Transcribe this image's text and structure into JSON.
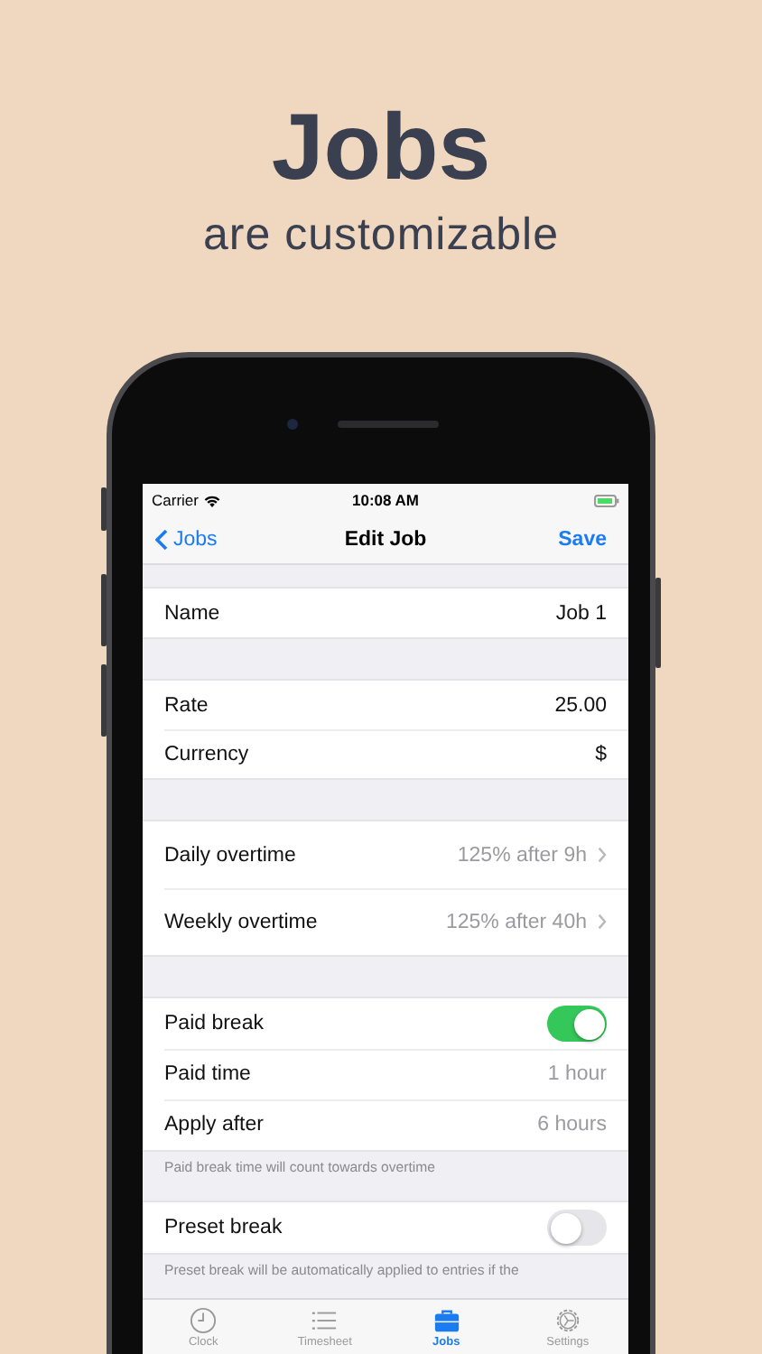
{
  "headline": "Jobs",
  "subheadline": "are customizable",
  "status_bar": {
    "carrier": "Carrier",
    "time": "10:08 AM"
  },
  "nav": {
    "back": "Jobs",
    "title": "Edit Job",
    "action": "Save"
  },
  "sections": [
    {
      "rows": [
        {
          "kind": "value",
          "label": "Name",
          "value": "Job 1"
        }
      ]
    },
    {
      "rows": [
        {
          "kind": "value",
          "label": "Rate",
          "value": "25.00"
        },
        {
          "kind": "value",
          "label": "Currency",
          "value": "$"
        }
      ]
    },
    {
      "rows": [
        {
          "kind": "disclosure",
          "label": "Daily overtime",
          "value": "125% after 9h"
        },
        {
          "kind": "disclosure",
          "label": "Weekly overtime",
          "value": "125% after 40h"
        }
      ]
    },
    {
      "rows": [
        {
          "kind": "toggle",
          "label": "Paid break",
          "on": true
        },
        {
          "kind": "detail",
          "label": "Paid time",
          "value": "1 hour"
        },
        {
          "kind": "detail",
          "label": "Apply after",
          "value": "6 hours"
        }
      ],
      "footer": "Paid break time will count towards overtime"
    },
    {
      "rows": [
        {
          "kind": "toggle",
          "label": "Preset break",
          "on": false
        }
      ],
      "footer": "Preset break will be automatically applied to entries if the"
    }
  ],
  "tabs": [
    {
      "kind": "clock",
      "label": "Clock",
      "selected": false
    },
    {
      "kind": "list",
      "label": "Timesheet",
      "selected": false
    },
    {
      "kind": "briefcase",
      "label": "Jobs",
      "selected": true
    },
    {
      "kind": "gear",
      "label": "Settings",
      "selected": false
    }
  ]
}
